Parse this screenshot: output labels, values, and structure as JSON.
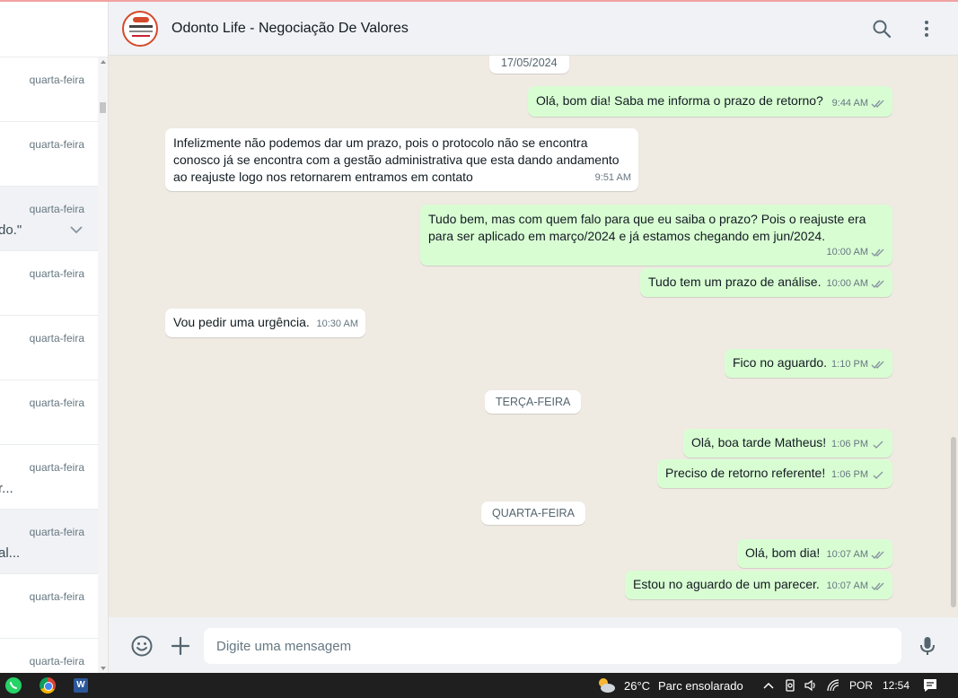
{
  "chat_list": {
    "rows": [
      {
        "time": "quarta-feira",
        "preview": ""
      },
      {
        "time": "quarta-feira",
        "preview": ""
      },
      {
        "time": "quarta-feira",
        "preview": "do.\""
      },
      {
        "time": "quarta-feira",
        "preview": ""
      },
      {
        "time": "quarta-feira",
        "preview": ""
      },
      {
        "time": "quarta-feira",
        "preview": ""
      },
      {
        "time": "quarta-feira",
        "preview": "r..."
      },
      {
        "time": "quarta-feira",
        "preview": "al..."
      },
      {
        "time": "quarta-feira",
        "preview": ""
      },
      {
        "time": "quarta-feira",
        "preview": ""
      }
    ]
  },
  "header": {
    "contact_name": "Odonto Life - Negociação De Valores",
    "search_icon": "search-icon",
    "menu_icon": "kebab-menu-icon"
  },
  "messages": {
    "date_top": "17/05/2024",
    "m1": {
      "text": "Olá, bom dia! Saba me informa o prazo de retorno?",
      "time": "9:44 AM"
    },
    "m2": {
      "text": "Infelizmente não podemos dar um prazo, pois o protocolo não se encontra conosco já se encontra com a gestão administrativa que esta dando andamento ao reajuste logo nos retornarem entramos em contato",
      "time": "9:51 AM"
    },
    "m3": {
      "text": "Tudo bem, mas com quem falo para que eu saiba o prazo? Pois o reajuste era para ser aplicado em março/2024 e já estamos chegando em jun/2024.",
      "time": "10:00 AM"
    },
    "m4": {
      "text": "Tudo tem um prazo de análise.",
      "time": "10:00 AM"
    },
    "m5": {
      "text": "Vou pedir uma urgência.",
      "time": "10:30 AM"
    },
    "m6": {
      "text": "Fico no aguardo.",
      "time": "1:10 PM"
    },
    "date_tue": "TERÇA-FEIRA",
    "m7": {
      "text": "Olá, boa tarde Matheus!",
      "time": "1:06 PM"
    },
    "m8": {
      "text": "Preciso de retorno referente!",
      "time": "1:06 PM"
    },
    "date_wed": "QUARTA-FEIRA",
    "m9": {
      "text": "Olá, bom dia!",
      "time": "10:07 AM"
    },
    "m10": {
      "text": "Estou no aguardo de um parecer.",
      "time": "10:07 AM"
    }
  },
  "composer": {
    "placeholder": "Digite uma mensagem"
  },
  "taskbar": {
    "temperature": "26°C",
    "condition": "Parc ensolarado",
    "language": "POR",
    "clock": "12:54"
  },
  "colors": {
    "outgoing_bubble": "#d9fdd3",
    "incoming_bubble": "#ffffff",
    "read_tick": "#53bdeb",
    "sent_tick": "#8696a0"
  }
}
